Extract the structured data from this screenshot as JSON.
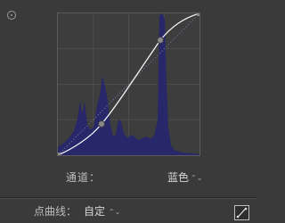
{
  "channel": {
    "label": "通道：",
    "value": "蓝色",
    "arrows": "⌃⌄"
  },
  "point_curve": {
    "label": "点曲线：",
    "value": "自定",
    "arrows": "⌃⌄"
  },
  "curve": {
    "channel_color": "#1f1f8a",
    "curve_color": "#ffffff",
    "control_points": [
      [
        0,
        0
      ],
      [
        0.31,
        0.23
      ],
      [
        0.72,
        0.81
      ],
      [
        1,
        1
      ]
    ]
  },
  "icons": {
    "targeted_adjustment": "target-icon",
    "edit_points": "curve-edit-icon",
    "channel_dropdown": "chevron-updown-icon",
    "point_curve_dropdown": "chevron-updown-icon"
  }
}
